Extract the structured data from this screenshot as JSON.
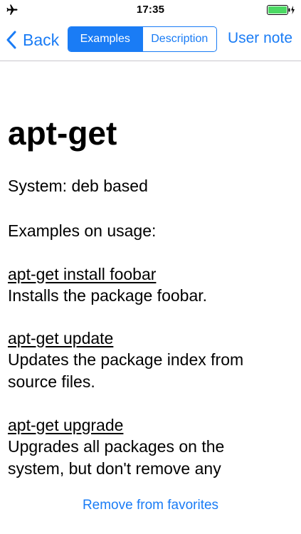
{
  "status_bar": {
    "time": "17:35",
    "icons": [
      "airplane-icon",
      "battery-icon",
      "charging-bolt-icon"
    ],
    "battery_color": "#4cd964"
  },
  "nav": {
    "back_label": "Back",
    "segments": [
      "Examples",
      "Description"
    ],
    "selected_segment": "Examples",
    "user_note_label": "User note",
    "accent_color": "#1a7cf5"
  },
  "page": {
    "title": "apt-get",
    "system_line": "System: deb based",
    "examples_heading": "Examples on usage:",
    "examples": [
      {
        "command": "apt-get install foobar",
        "description_lines": [
          "Installs the package foobar."
        ]
      },
      {
        "command": "apt-get update",
        "description_lines": [
          "Updates the package index from",
          "source files."
        ]
      },
      {
        "command": "apt-get upgrade",
        "description_lines": [
          "Upgrades all packages on the",
          "system, but don't remove any"
        ]
      }
    ]
  },
  "footer": {
    "remove_favorites_label": "Remove from favorites"
  }
}
